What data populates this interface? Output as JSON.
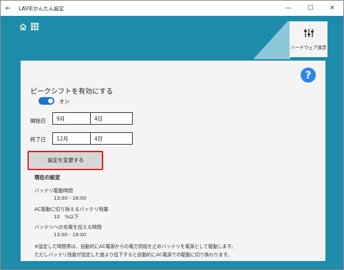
{
  "window": {
    "title": "LAVIEかんたん設定",
    "back_glyph": "←",
    "minimize_glyph": "—",
    "maximize_glyph": "☐",
    "close_glyph": "✕"
  },
  "header": {
    "home_icon": "home-icon",
    "apps_icon": "apps-grid-icon",
    "hardware_tile_label": "ハードウェア設定",
    "hardware_icon": "sliders-icon"
  },
  "panel": {
    "help_glyph": "?",
    "section_title": "ピークシフトを有効にする",
    "toggle_state": "オン",
    "toggle_on": true,
    "start_label": "開始日",
    "start_month": "9月",
    "start_day": "4日",
    "end_label": "終了日",
    "end_month": "12月",
    "end_day": "4日",
    "change_button": "設定を変更する",
    "current_heading": "現在の設定",
    "battery_time_label": "バッテリ駆動時間",
    "battery_time_value": "13:00 - 16:00",
    "ac_switch_label": "AC駆動に切り換えるバッテリ残量",
    "ac_switch_value": "10　%以下",
    "charge_limit_label": "バッテリへの充電を控える時間",
    "charge_limit_value": "13:00 - 18:00",
    "note_line1": "※設定した時間帯は、自動的にAC電源からの電力供給を止めバッテリを電源として駆動します。",
    "note_line2": "ただしバッテリ残量が設定した値より低下すると自動的にAC電源での駆動に切り換わります。"
  },
  "colors": {
    "teal_background": "#1f8bab",
    "panel_background": "#f4f4f4",
    "toggle_blue": "#1e72d0",
    "help_blue": "#2d86e8",
    "highlight_red": "#e8191c",
    "button_gray": "#d6d6d6"
  }
}
